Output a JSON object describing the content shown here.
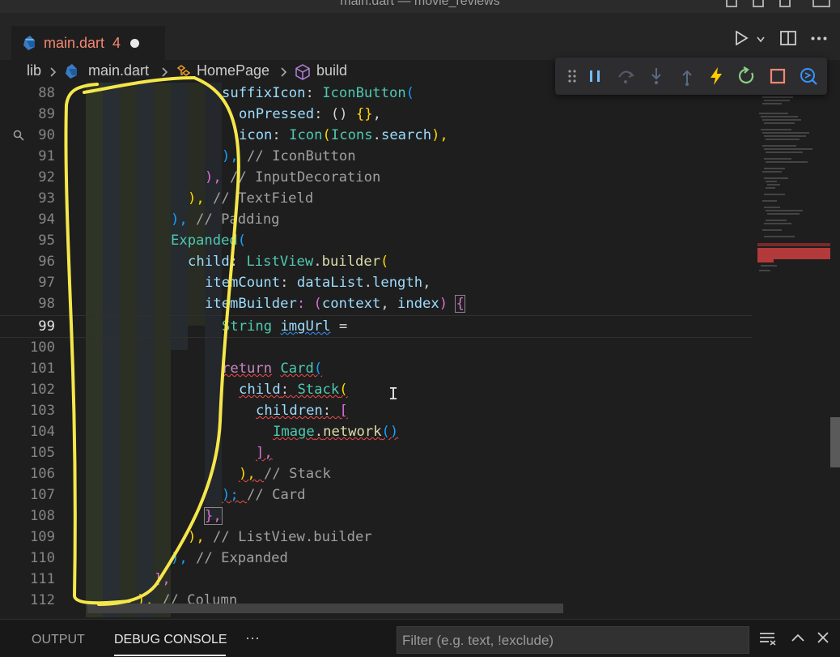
{
  "window": {
    "title": "main.dart — movie_reviews"
  },
  "tab": {
    "filename": "main.dart",
    "problem_count": "4"
  },
  "breadcrumb": {
    "items": [
      "lib",
      "main.dart",
      "HomePage",
      "build"
    ]
  },
  "editor": {
    "current_line": 99,
    "lines": [
      {
        "n": "88"
      },
      {
        "n": "89"
      },
      {
        "n": "90"
      },
      {
        "n": "91"
      },
      {
        "n": "92"
      },
      {
        "n": "93"
      },
      {
        "n": "94"
      },
      {
        "n": "95"
      },
      {
        "n": "96"
      },
      {
        "n": "97"
      },
      {
        "n": "98"
      },
      {
        "n": "99"
      },
      {
        "n": "100"
      },
      {
        "n": "101"
      },
      {
        "n": "102"
      },
      {
        "n": "103"
      },
      {
        "n": "104"
      },
      {
        "n": "105"
      },
      {
        "n": "106"
      },
      {
        "n": "107"
      },
      {
        "n": "108"
      },
      {
        "n": "109"
      },
      {
        "n": "110"
      },
      {
        "n": "111"
      },
      {
        "n": "112"
      }
    ],
    "code": {
      "l88": {
        "a": "suffixIcon",
        "b": ": ",
        "c": "IconButton",
        "d": "("
      },
      "l89": {
        "a": "onPressed",
        "b": ": () ",
        "c": "{}",
        "d": ","
      },
      "l90": {
        "a": "icon",
        "b": ": ",
        "c": "Icon",
        "d": "(",
        "e": "Icons",
        "f": ".",
        "g": "search",
        "h": "),"
      },
      "l91": {
        "a": "), ",
        "b": "// IconButton"
      },
      "l92": {
        "a": "), ",
        "b": "// InputDecoration"
      },
      "l93": {
        "a": "), ",
        "b": "// TextField"
      },
      "l94": {
        "a": "), ",
        "b": "// Padding"
      },
      "l95": {
        "a": "Expanded",
        "b": "("
      },
      "l96": {
        "a": "child",
        "b": ": ",
        "c": "ListView",
        "d": ".",
        "e": "builder",
        "f": "("
      },
      "l97": {
        "a": "itemCount",
        "b": ": ",
        "c": "dataList",
        "d": ".",
        "e": "length",
        "f": ","
      },
      "l98": {
        "a": "itemBuilder",
        "b": ": (",
        "c": "context",
        "d": ", ",
        "e": "index",
        "f": ") ",
        "g": "{"
      },
      "l99": {
        "a": "String",
        "b": " ",
        "c": "imgUrl",
        "d": " ="
      },
      "l101": {
        "a": "return",
        "b": " ",
        "c": "Card",
        "d": "("
      },
      "l102": {
        "a": "child",
        "b": ": ",
        "c": "Stack",
        "d": "("
      },
      "l103": {
        "a": "children",
        "b": ": ",
        "c": "["
      },
      "l104": {
        "a": "Image",
        "b": ".",
        "c": "network",
        "d": "()"
      },
      "l105": {
        "a": "],"
      },
      "l106": {
        "a": "), ",
        "b": "// Stack"
      },
      "l107": {
        "a": "); ",
        "b": "// Card"
      },
      "l108": {
        "a": "},"
      },
      "l109": {
        "a": "), ",
        "b": "// ListView.builder"
      },
      "l110": {
        "a": "), ",
        "b": "// Expanded"
      },
      "l111": {
        "a": "],"
      },
      "l112": {
        "a": "), ",
        "b": "// Column"
      }
    }
  },
  "panel": {
    "tabs": [
      "OUTPUT",
      "DEBUG CONSOLE"
    ],
    "more": "···",
    "filter_placeholder": "Filter (e.g. text, !exclude)"
  },
  "colors": {
    "background": "#1e1e1e",
    "error": "#f14c4c",
    "accent": "#3794ff",
    "annotation": "#f5e74a"
  },
  "icons": [
    "dart-file-icon",
    "run-icon",
    "split-editor-icon",
    "more-actions-icon",
    "class-icon",
    "method-icon",
    "drag-handle-icon",
    "pause-icon",
    "step-over-icon",
    "step-into-icon",
    "step-out-icon",
    "hot-reload-icon",
    "restart-icon",
    "stop-icon",
    "devtools-icon",
    "clear-console-icon",
    "maximize-panel-icon",
    "close-panel-icon"
  ]
}
